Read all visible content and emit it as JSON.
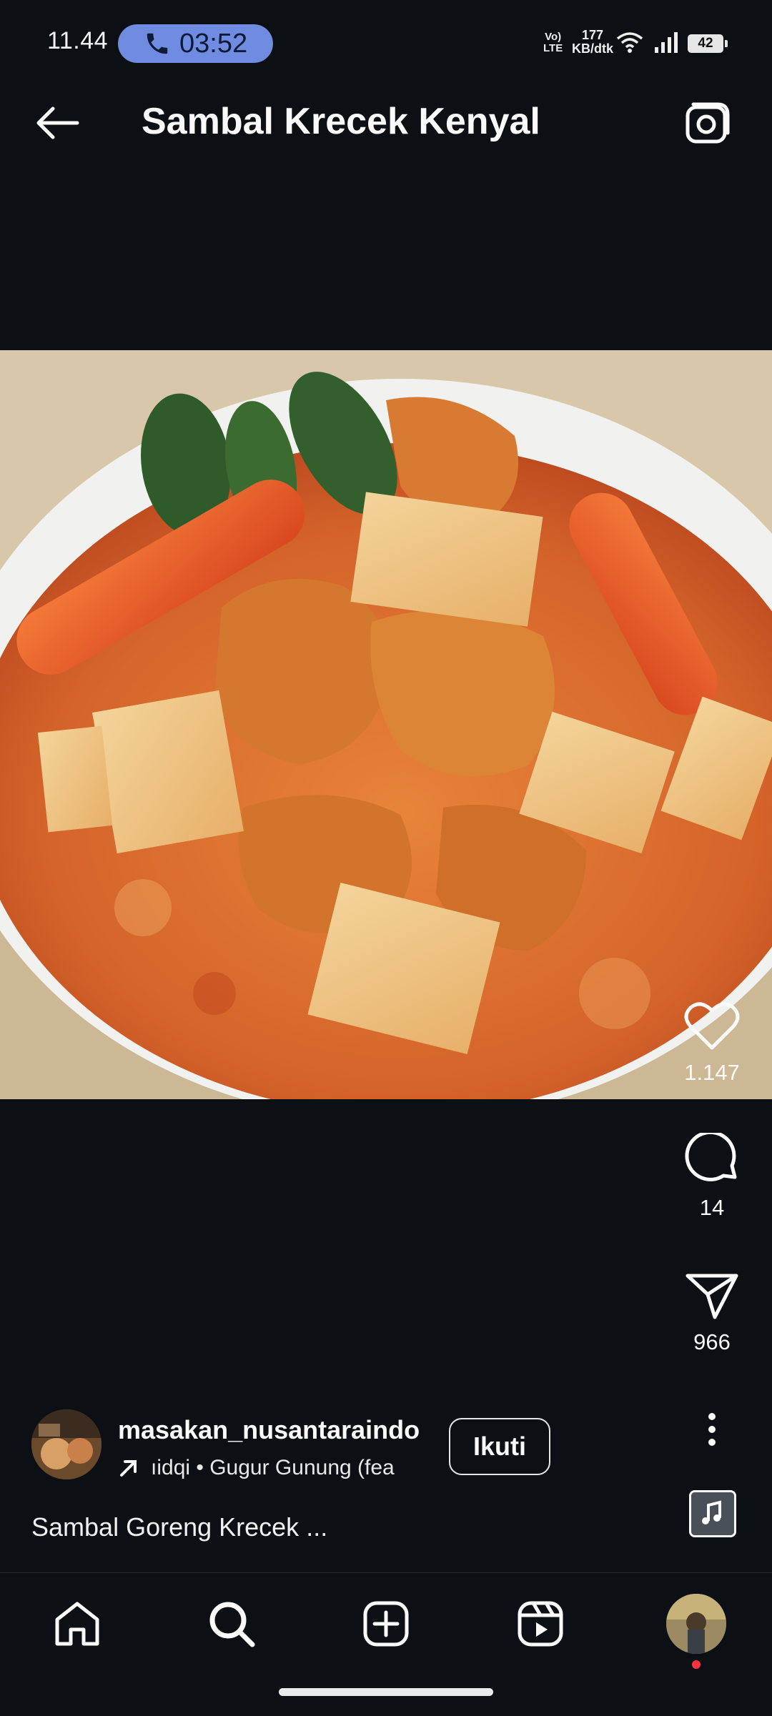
{
  "status_bar": {
    "time": "11.44",
    "call_timer": "03:52",
    "volte_line1": "Vo)",
    "volte_line2": "LTE",
    "net_speed_value": "177",
    "net_speed_unit": "KB/dtk",
    "battery": "42"
  },
  "header": {
    "title": "Sambal Krecek Kenyal",
    "back_icon": "arrow-left-icon",
    "camera_icon": "camera-icon"
  },
  "actions": {
    "likes": "1.147",
    "comments": "14",
    "shares": "966"
  },
  "post": {
    "username": "masakan_nusantaraindo",
    "audio": " ıidqi • Gugur Gunung (fea",
    "follow_label": "Ikuti",
    "caption": "Sambal Goreng Krecek ..."
  },
  "colors": {
    "background": "#0c1014",
    "call_pill": "#6f8ce0",
    "notification_dot": "#ff3040"
  }
}
